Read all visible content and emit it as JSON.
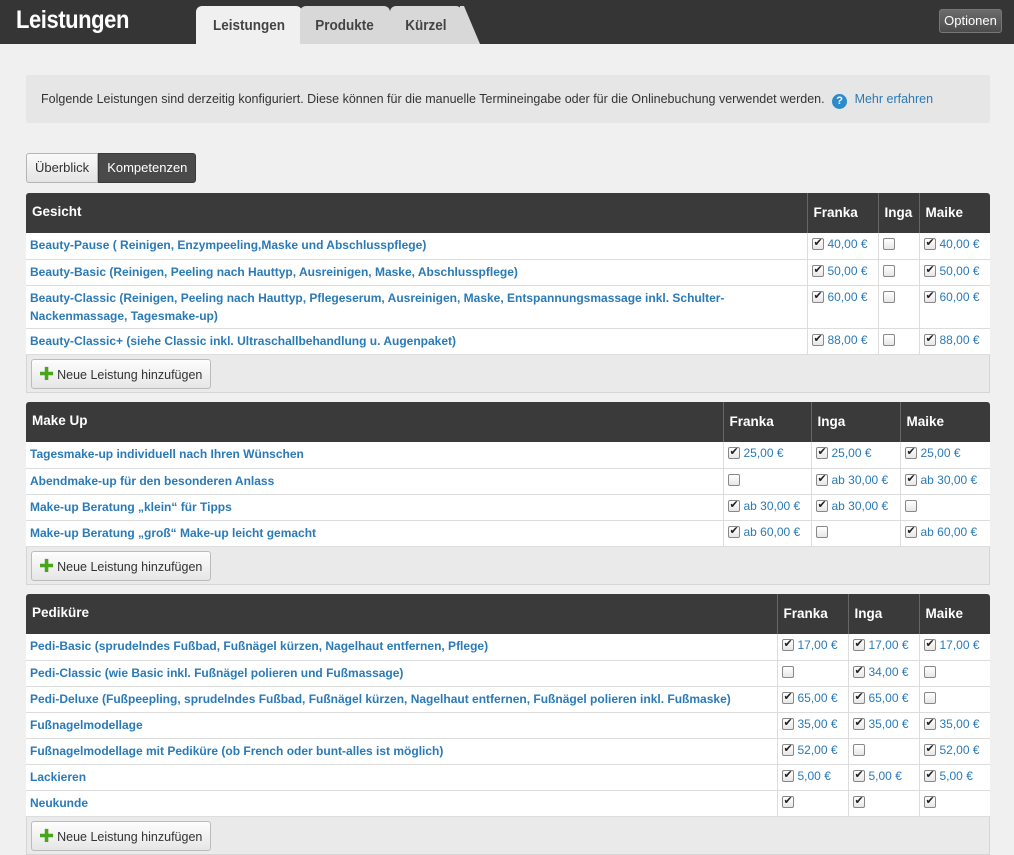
{
  "header": {
    "app_title": "Leistungen",
    "tabs": [
      {
        "label": "Leistungen",
        "active": true
      },
      {
        "label": "Produkte",
        "active": false
      },
      {
        "label": "Kürzel",
        "active": false
      }
    ],
    "options_label": "Optionen"
  },
  "info": {
    "text": "Folgende Leistungen sind derzeitig konfiguriert. Diese können für die manuelle Termineingabe oder für die Onlinebuchung verwendet werden.",
    "help_glyph": "?",
    "link": "Mehr erfahren"
  },
  "view_toggle": {
    "overview": "Überblick",
    "competences": "Kompetenzen",
    "active": "competences"
  },
  "add_label": "Neue Leistung hinzufügen",
  "groups": [
    {
      "name": "Gesicht",
      "employees": [
        "Franka",
        "Inga",
        "Maike"
      ],
      "services": [
        {
          "name": "Beauty-Pause ( Reinigen, Enzympeeling,Maske und Abschlusspflege)",
          "cells": [
            {
              "checked": true,
              "price": "40,00 €"
            },
            {
              "checked": false,
              "price": ""
            },
            {
              "checked": true,
              "price": "40,00 €"
            }
          ]
        },
        {
          "name": "Beauty-Basic (Reinigen, Peeling nach Hauttyp, Ausreinigen, Maske, Abschlusspflege)",
          "cells": [
            {
              "checked": true,
              "price": "50,00 €"
            },
            {
              "checked": false,
              "price": ""
            },
            {
              "checked": true,
              "price": "50,00 €"
            }
          ]
        },
        {
          "name": "Beauty-Classic (Reinigen, Peeling nach Hauttyp, Pflegeserum, Ausreinigen, Maske, Entspannungsmassage inkl. Schulter-Nackenmassage, Tagesmake-up)",
          "cells": [
            {
              "checked": true,
              "price": "60,00 €"
            },
            {
              "checked": false,
              "price": ""
            },
            {
              "checked": true,
              "price": "60,00 €"
            }
          ]
        },
        {
          "name": "Beauty-Classic+ (siehe Classic inkl. Ultraschallbehandlung u. Augenpaket)",
          "cells": [
            {
              "checked": true,
              "price": "88,00 €"
            },
            {
              "checked": false,
              "price": ""
            },
            {
              "checked": true,
              "price": "88,00 €"
            }
          ]
        }
      ]
    },
    {
      "name": "Make Up",
      "employees": [
        "Franka",
        "Inga",
        "Maike"
      ],
      "services": [
        {
          "name": "Tagesmake-up individuell nach Ihren Wünschen",
          "cells": [
            {
              "checked": true,
              "price": "25,00 €"
            },
            {
              "checked": true,
              "price": "25,00 €"
            },
            {
              "checked": true,
              "price": "25,00 €"
            }
          ]
        },
        {
          "name": "Abendmake-up für den besonderen Anlass",
          "cells": [
            {
              "checked": false,
              "price": ""
            },
            {
              "checked": true,
              "price": "ab 30,00 €"
            },
            {
              "checked": true,
              "price": "ab 30,00 €"
            }
          ]
        },
        {
          "name": "Make-up Beratung „klein“ für Tipps",
          "cells": [
            {
              "checked": true,
              "price": "ab 30,00 €"
            },
            {
              "checked": true,
              "price": "ab 30,00 €"
            },
            {
              "checked": false,
              "price": ""
            }
          ]
        },
        {
          "name": "Make-up Beratung „groß“ Make-up leicht gemacht",
          "cells": [
            {
              "checked": true,
              "price": "ab 60,00 €"
            },
            {
              "checked": false,
              "price": ""
            },
            {
              "checked": true,
              "price": "ab 60,00 €"
            }
          ]
        }
      ]
    },
    {
      "name": "Pediküre",
      "employees": [
        "Franka",
        "Inga",
        "Maike"
      ],
      "services": [
        {
          "name": "Pedi-Basic (sprudelndes Fußbad, Fußnägel kürzen, Nagelhaut entfernen, Pflege)",
          "cells": [
            {
              "checked": true,
              "price": "17,00 €"
            },
            {
              "checked": true,
              "price": "17,00 €"
            },
            {
              "checked": true,
              "price": "17,00 €"
            }
          ]
        },
        {
          "name": "Pedi-Classic (wie Basic inkl. Fußnägel polieren und Fußmassage)",
          "cells": [
            {
              "checked": false,
              "price": ""
            },
            {
              "checked": true,
              "price": "34,00 €"
            },
            {
              "checked": false,
              "price": ""
            }
          ]
        },
        {
          "name": "Pedi-Deluxe (Fußpeepling, sprudelndes Fußbad, Fußnägel kürzen, Nagelhaut entfernen, Fußnägel polieren inkl. Fußmaske)",
          "cells": [
            {
              "checked": true,
              "price": "65,00 €"
            },
            {
              "checked": true,
              "price": "65,00 €"
            },
            {
              "checked": false,
              "price": ""
            }
          ]
        },
        {
          "name": "Fußnagelmodellage",
          "cells": [
            {
              "checked": true,
              "price": "35,00 €"
            },
            {
              "checked": true,
              "price": "35,00 €"
            },
            {
              "checked": true,
              "price": "35,00 €"
            }
          ]
        },
        {
          "name": "Fußnagelmodellage mit Pediküre (ob French oder bunt-alles ist möglich)",
          "cells": [
            {
              "checked": true,
              "price": "52,00 €"
            },
            {
              "checked": false,
              "price": ""
            },
            {
              "checked": true,
              "price": "52,00 €"
            }
          ]
        },
        {
          "name": "Lackieren",
          "cells": [
            {
              "checked": true,
              "price": "5,00 €"
            },
            {
              "checked": true,
              "price": "5,00 €"
            },
            {
              "checked": true,
              "price": "5,00 €"
            }
          ]
        },
        {
          "name": "Neukunde",
          "cells": [
            {
              "checked": true,
              "price": ""
            },
            {
              "checked": true,
              "price": ""
            },
            {
              "checked": true,
              "price": ""
            }
          ]
        }
      ]
    }
  ]
}
